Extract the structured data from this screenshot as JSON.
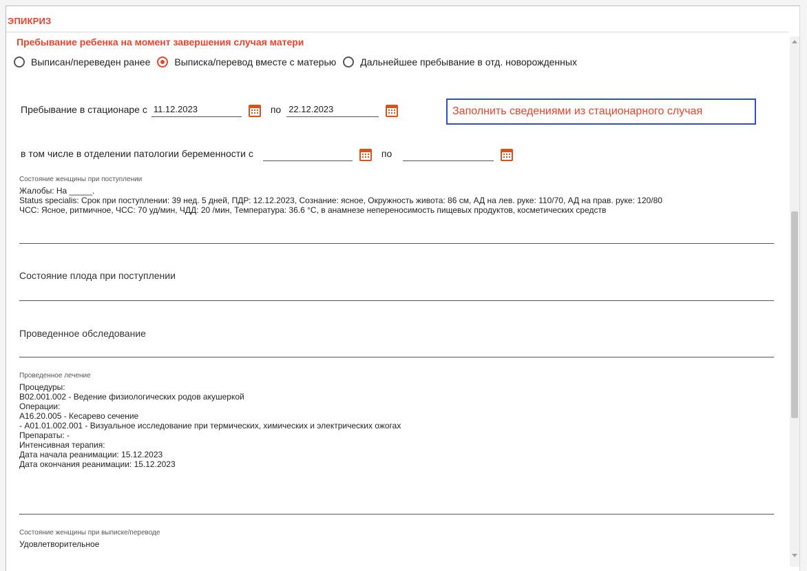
{
  "section": {
    "title": "ЭПИКРИЗ"
  },
  "child_stay": {
    "title": "Пребывание ребенка на момент завершения случая матери",
    "options": [
      {
        "label": "Выписан/переведен ранее",
        "selected": false
      },
      {
        "label": "Выписка/перевод вместе с матерью",
        "selected": true
      },
      {
        "label": "Дальнейшее пребывание в отд. новорожденных",
        "selected": false
      }
    ]
  },
  "hospital_stay": {
    "label": "Пребывание в стационаре с",
    "from": "11.12.2023",
    "to_label": "по",
    "to": "22.12.2023",
    "fill_button": "Заполнить сведениями из стационарного случая"
  },
  "pathology_stay": {
    "label": "в том числе в отделении патологии беременности с",
    "from": "",
    "to_label": "по",
    "to": ""
  },
  "woman_admission": {
    "label": "Состояние женщины при поступлении",
    "text": "Жалобы: На _____.\nStatus specialis: Срок при поступлении: 39 нед. 5 дней, ПДР: 12.12.2023, Сознание: ясное, Окружность живота: 86 см, АД на лев. руке: 110/70, АД на прав. руке: 120/80\nЧСС: Ясное, ритмичное, ЧСС: 70 уд/мин, ЧДД: 20 /мин, Температура: 36.6 °C, в анамнезе непереносимость пищевых продуктов, косметических средств"
  },
  "fetus_admission": {
    "label": "Состояние плода при поступлении"
  },
  "examination": {
    "label": "Проведенное обследование"
  },
  "treatment": {
    "label": "Проведенное лечение",
    "text": "Процедуры:\nB02.001.002 - Ведение физиологических родов акушеркой\nОперации:\nA16.20.005 - Кесарево сечение\n- A01.01.002.001 - Визуальное исследование при термических, химических и электрических ожогах\nПрепараты: -\nИнтенсивная терапия:\nДата начала реанимации: 15.12.2023\nДата окончания реанимации: 15.12.2023"
  },
  "woman_discharge": {
    "label": "Состояние женщины при выписке/переводе",
    "text": "Удовлетворительное"
  },
  "colors": {
    "accent": "#e8452c",
    "button_border": "#2f4fd1",
    "calendar": "#d9531e"
  },
  "icons": {
    "calendar": "calendar-icon"
  }
}
